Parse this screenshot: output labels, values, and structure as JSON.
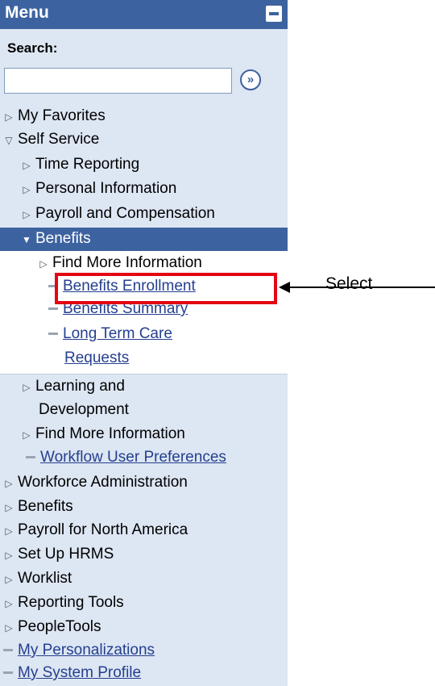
{
  "menu": {
    "title": "Menu",
    "search_label": "Search:",
    "search_value": "",
    "go_glyph": "»"
  },
  "nav": {
    "my_favorites": "My Favorites",
    "self_service": "Self Service",
    "time_reporting": "Time Reporting",
    "personal_information": "Personal Information",
    "payroll_and_compensation": "Payroll and Compensation",
    "benefits": "Benefits",
    "find_more_information": "Find More Information",
    "benefits_enrollment": "Benefits Enrollment",
    "benefits_summary": "Benefits Summary",
    "long_term_care_line1": "Long Term Care",
    "long_term_care_line2": "Requests",
    "learning_line1": "Learning and",
    "learning_line2": "Development",
    "find_more_information_2": "Find More Information",
    "workflow_user_preferences": "Workflow User Preferences",
    "workforce_administration": "Workforce Administration",
    "benefits_root": "Benefits",
    "payroll_for_north_america": "Payroll for North America",
    "set_up_hrms": "Set Up HRMS",
    "worklist": "Worklist",
    "reporting_tools": "Reporting Tools",
    "peopletools": "PeopleTools",
    "my_personalizations": "My Personalizations",
    "my_system_profile": "My System Profile"
  },
  "annotation": {
    "label": "Select"
  },
  "colors": {
    "header": "#3d62a0",
    "menu_bg": "#dde6f3",
    "link": "#243f8e",
    "highlight_box": "#e30613"
  }
}
